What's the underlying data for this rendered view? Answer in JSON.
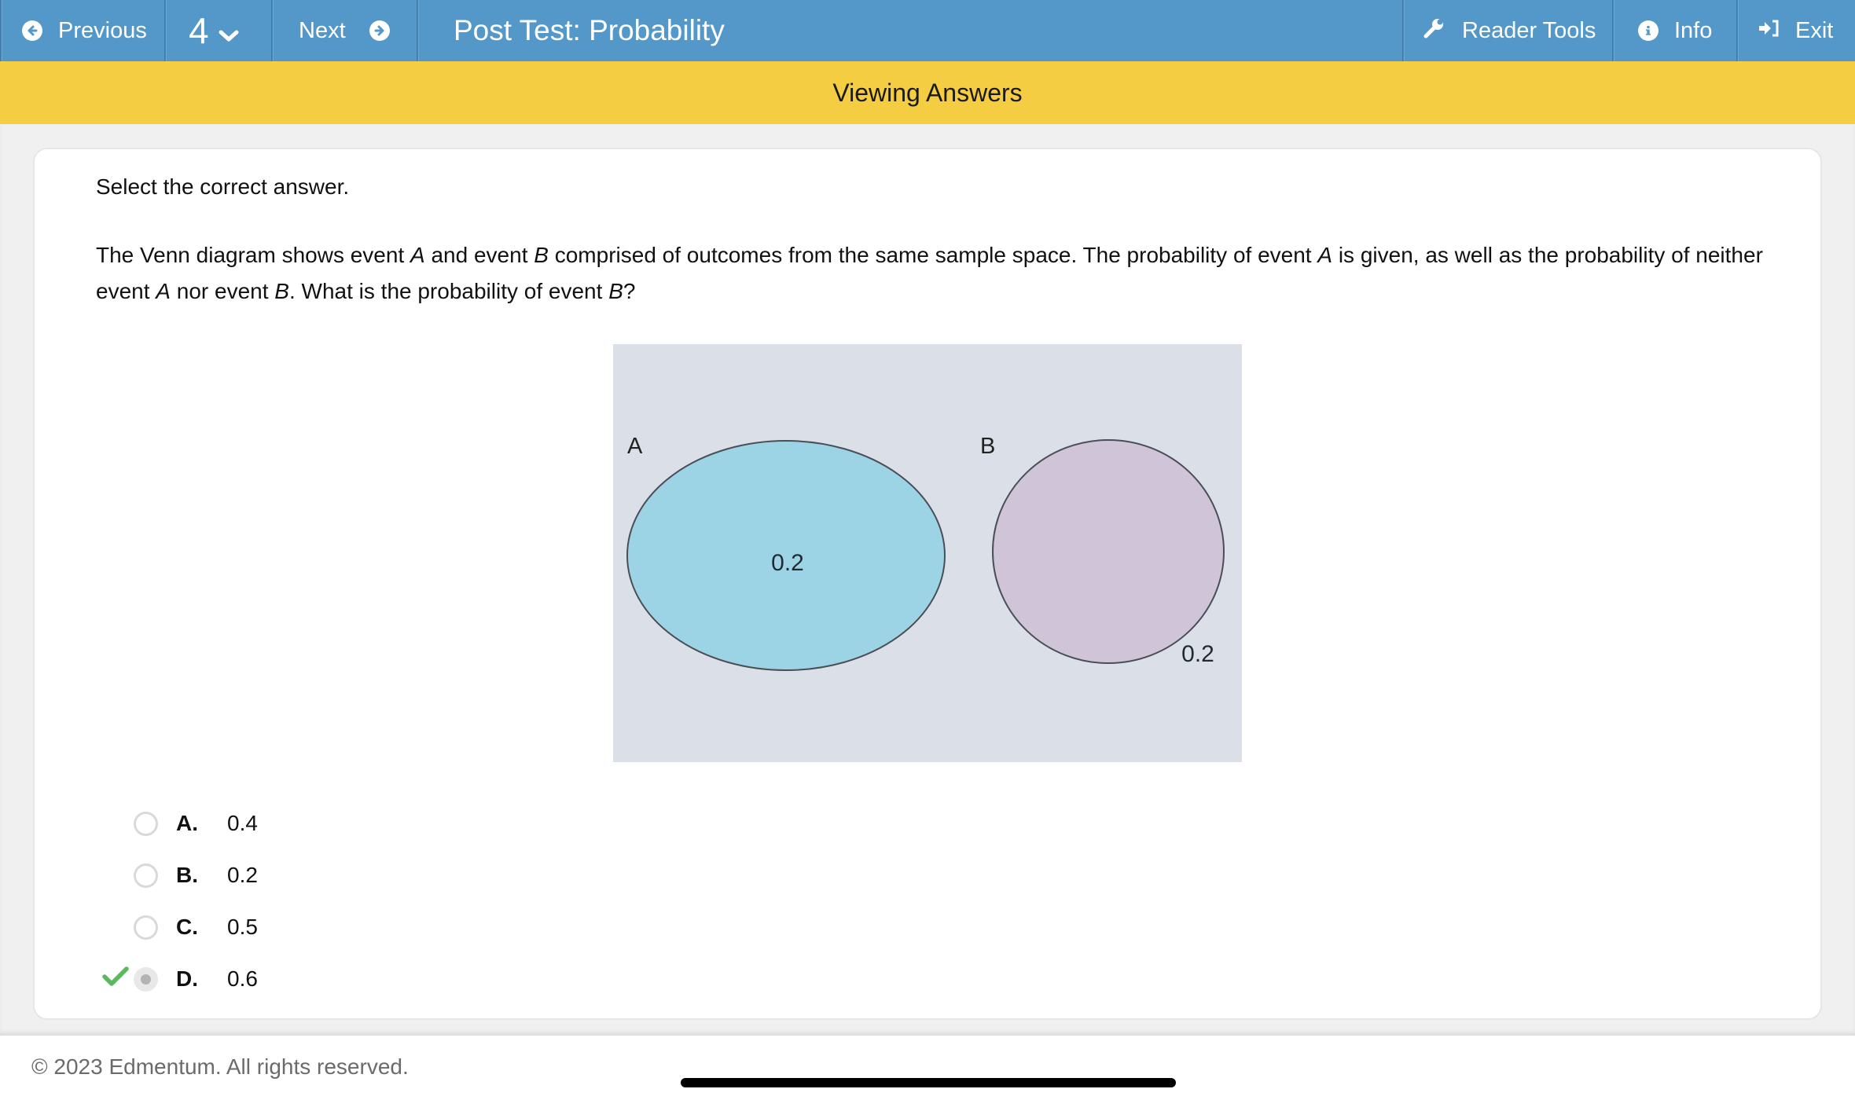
{
  "topnav": {
    "previous_label": "Previous",
    "question_number": "4",
    "next_label": "Next",
    "title": "Post Test: Probability",
    "reader_tools_label": "Reader Tools",
    "info_label": "Info",
    "exit_label": "Exit",
    "icons": {
      "previous": "arrow-circle-left-icon",
      "question_dropdown": "chevron-down-icon",
      "next": "arrow-circle-right-icon",
      "reader_tools": "wrench-icon",
      "info": "info-circle-icon",
      "exit": "sign-out-icon"
    }
  },
  "banner": {
    "text": "Viewing Answers"
  },
  "question": {
    "instruction": "Select the correct answer.",
    "text_parts": [
      {
        "text": "The Venn diagram shows event ",
        "italic": false
      },
      {
        "text": "A",
        "italic": true
      },
      {
        "text": " and event ",
        "italic": false
      },
      {
        "text": "B",
        "italic": true
      },
      {
        "text": " comprised of outcomes from the same sample space. The probability of event ",
        "italic": false
      },
      {
        "text": "A",
        "italic": true
      },
      {
        "text": " is given, as well as the probability of neither event ",
        "italic": false
      },
      {
        "text": "A",
        "italic": true
      },
      {
        "text": " nor event ",
        "italic": false
      },
      {
        "text": "B",
        "italic": true
      },
      {
        "text": ". What is the probability of event ",
        "italic": false
      },
      {
        "text": "B",
        "italic": true
      },
      {
        "text": "?",
        "italic": false
      }
    ]
  },
  "venn_diagram": {
    "sets": [
      {
        "label": "A",
        "value_label": "0.2",
        "fill": "#9dd4e5"
      },
      {
        "label": "B",
        "value_label": "",
        "fill": "#cfc4d8"
      }
    ],
    "outside_value_label": "0.2",
    "background": "#dbe0e8",
    "stroke": "#4a4f57"
  },
  "answers": {
    "options": [
      {
        "letter": "A.",
        "value": "0.4",
        "selected": false,
        "correct": false
      },
      {
        "letter": "B.",
        "value": "0.2",
        "selected": false,
        "correct": false
      },
      {
        "letter": "C.",
        "value": "0.5",
        "selected": false,
        "correct": false
      },
      {
        "letter": "D.",
        "value": "0.6",
        "selected": true,
        "correct": true
      }
    ],
    "correct_icon": "checkmark-icon",
    "correct_color": "#5cb85c"
  },
  "footer": {
    "copyright": "© 2023 Edmentum. All rights reserved."
  },
  "colors": {
    "nav_blue": "#5497c9",
    "banner_yellow": "#f5cd43",
    "page_gray": "#f0f0f0"
  }
}
